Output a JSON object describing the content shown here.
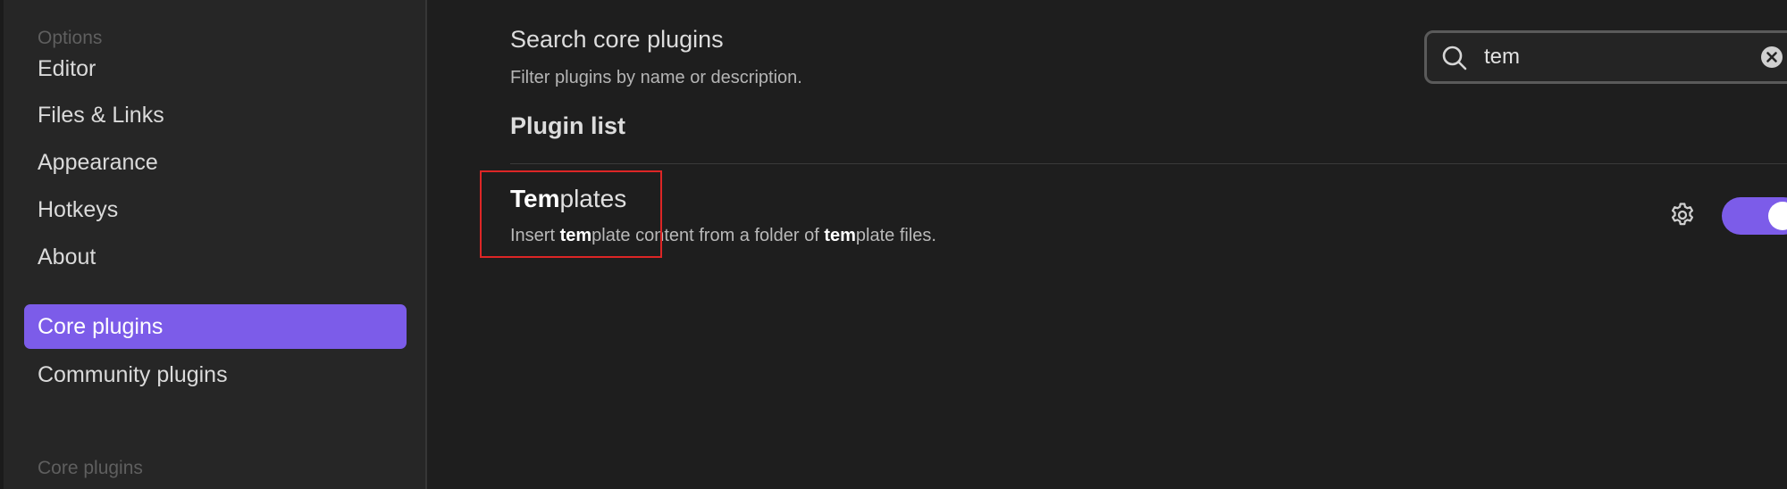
{
  "sidebar": {
    "options_header": "Options",
    "items": [
      {
        "label": "Editor"
      },
      {
        "label": "Files & Links"
      },
      {
        "label": "Appearance"
      },
      {
        "label": "Hotkeys"
      },
      {
        "label": "About"
      },
      {
        "label": "Core plugins",
        "active": true
      },
      {
        "label": "Community plugins"
      }
    ],
    "core_plugins_header": "Core plugins"
  },
  "main": {
    "search_setting": {
      "name": "Search core plugins",
      "description": "Filter plugins by name or description.",
      "value": "tem"
    },
    "plugin_list_heading": "Plugin list",
    "plugins": [
      {
        "title_match": "Tem",
        "title_rest": "plates",
        "desc_parts": [
          "Insert ",
          "tem",
          "plate content from a folder of ",
          "tem",
          "plate files."
        ],
        "enabled": true
      }
    ]
  },
  "colors": {
    "accent": "#7c5ce9",
    "highlight_border": "#dd2626",
    "background": "#1e1e1e",
    "sidebar_background": "#262626"
  },
  "icons": {
    "search": "search-icon",
    "clear": "clear-icon",
    "settings": "gear-icon"
  }
}
